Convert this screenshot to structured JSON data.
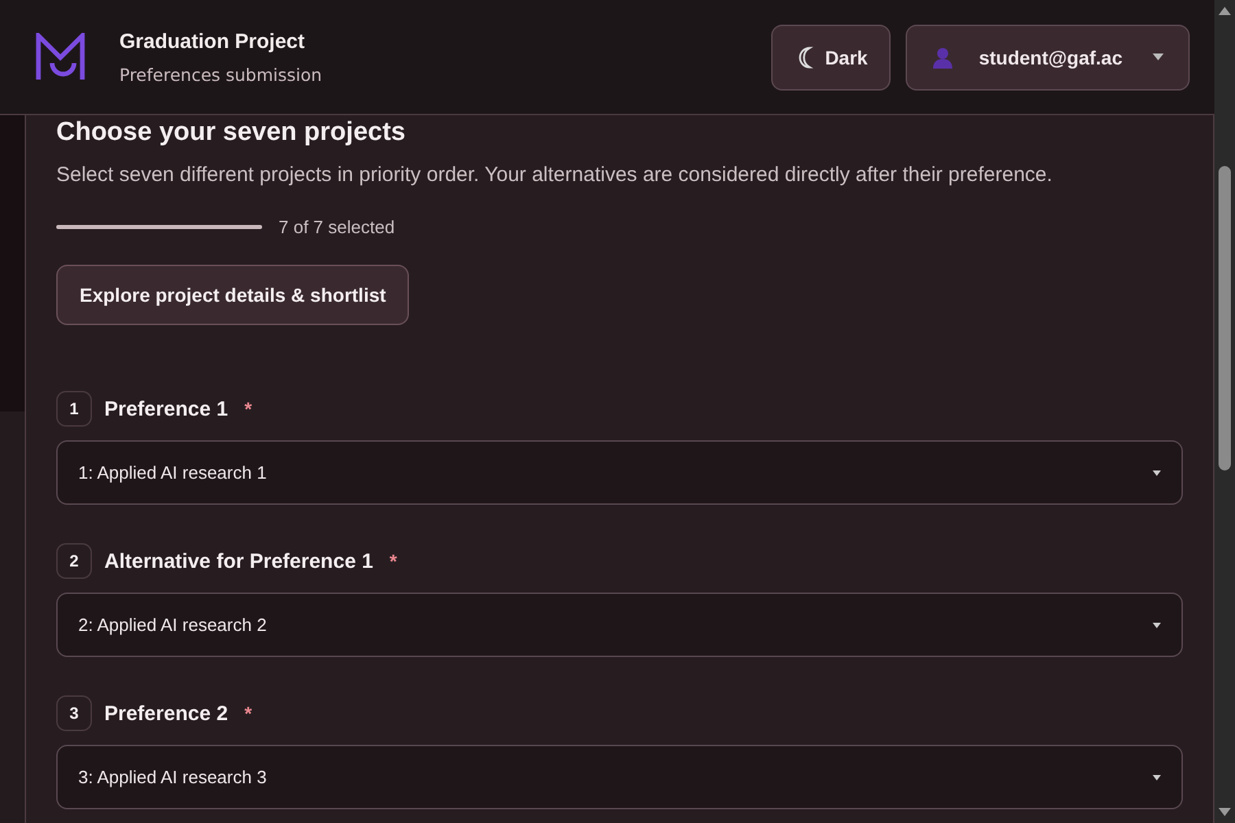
{
  "header": {
    "title": "Graduation Project",
    "subtitle": "Preferences submission",
    "theme_button": {
      "label": "Dark"
    },
    "user_button": {
      "label": "student@gaf.ac"
    }
  },
  "section": {
    "title": "Choose your seven projects",
    "description": "Select seven different projects in priority order. Your alternatives are considered directly after their preference.",
    "progress": {
      "level": 1,
      "reading": "7 of 7 selected"
    },
    "explore_button": "Explore project details & shortlist"
  },
  "preferences": [
    {
      "number": "1",
      "label": "Preference 1",
      "required": true,
      "required_mark": "*",
      "value": "1: Applied AI research 1"
    },
    {
      "number": "2",
      "label": "Alternative for Preference 1",
      "required": true,
      "required_mark": "*",
      "value": "2: Applied AI research 2"
    },
    {
      "number": "3",
      "label": "Preference 2",
      "required": true,
      "required_mark": "*",
      "value": "3: Applied AI research 3"
    }
  ]
}
